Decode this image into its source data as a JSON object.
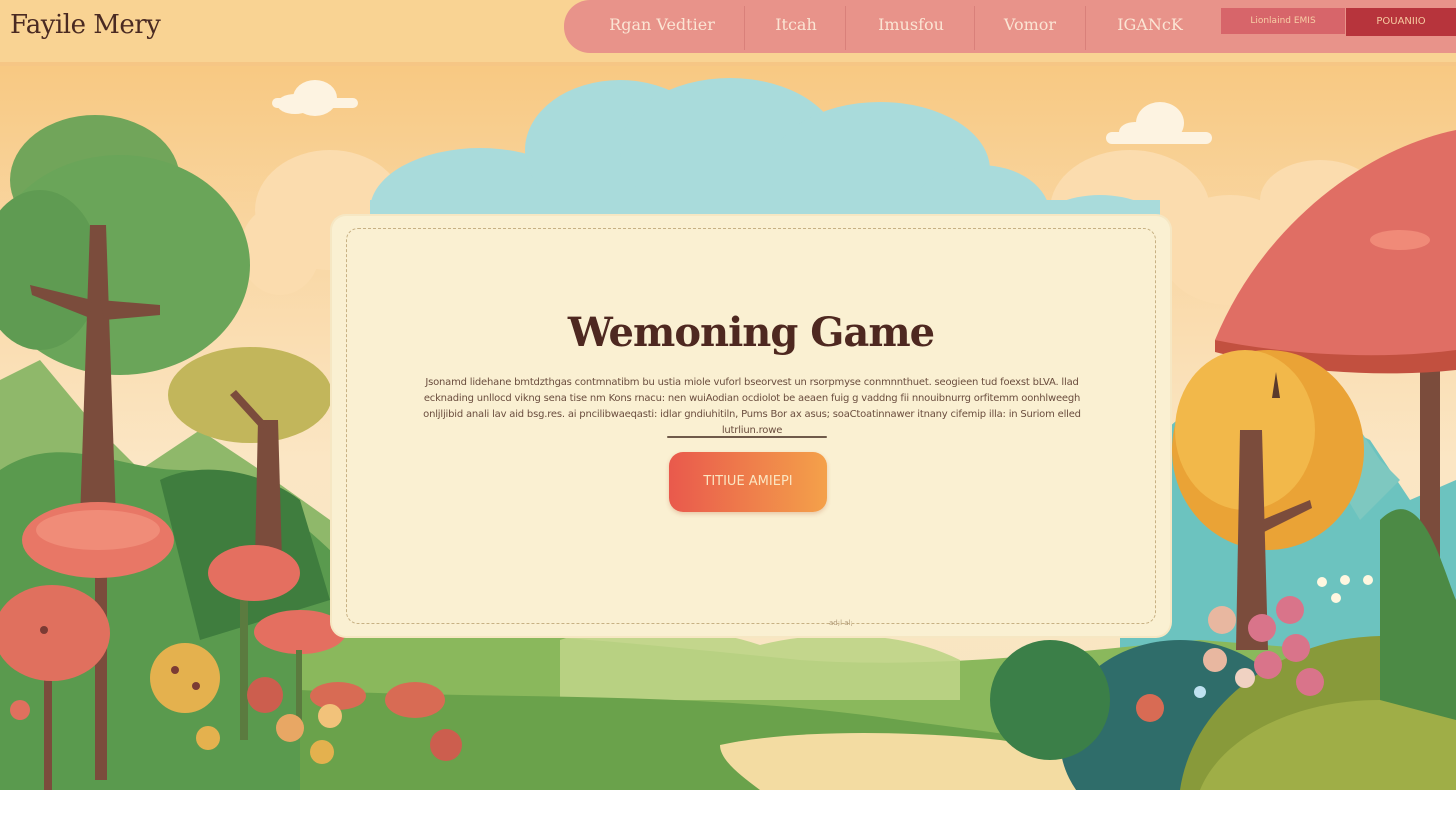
{
  "header": {
    "logo": "Fayile Mery",
    "nav": [
      {
        "label": "Rgan  Vedtier"
      },
      {
        "label": "Itcah"
      },
      {
        "label": "Imusfou"
      },
      {
        "label": "Vomor"
      },
      {
        "label": "IGANcK"
      }
    ],
    "button_secondary": "Lionlaind EMIS",
    "button_primary": "POUANIIO"
  },
  "card": {
    "title": "Wemoning Game",
    "description": "Jsonamd lidehane bmtdzthgas contmnatibm bu ustia miole vuforl bseorvest un rsorpmyse conmnnthuet. seogieen tud foexst bLVA. llad ecknading unllocd vikng sena tise nm Kons rnacu: nen wuiAodian ocdiolot be aeaen fuig g vaddng fii nnouibnurrg orfitemm oonhlweegh onljljibid anali lav aid bsg.res. ai pncilibwaeqasti: idlar gndiuhitiln, Pums Bor ax asus; soaCtoatinnawer itnany cifemip illa: in Suriom elled lutrliun.rowe",
    "cta": "TITIUE AMIEPI",
    "caption": "ad;l al;"
  },
  "colors": {
    "nav_bg": "#e8938a",
    "cta_start": "#e9594c",
    "cta_end": "#f4a14a",
    "title": "#4e2820",
    "card_bg": "#faf0d2"
  }
}
